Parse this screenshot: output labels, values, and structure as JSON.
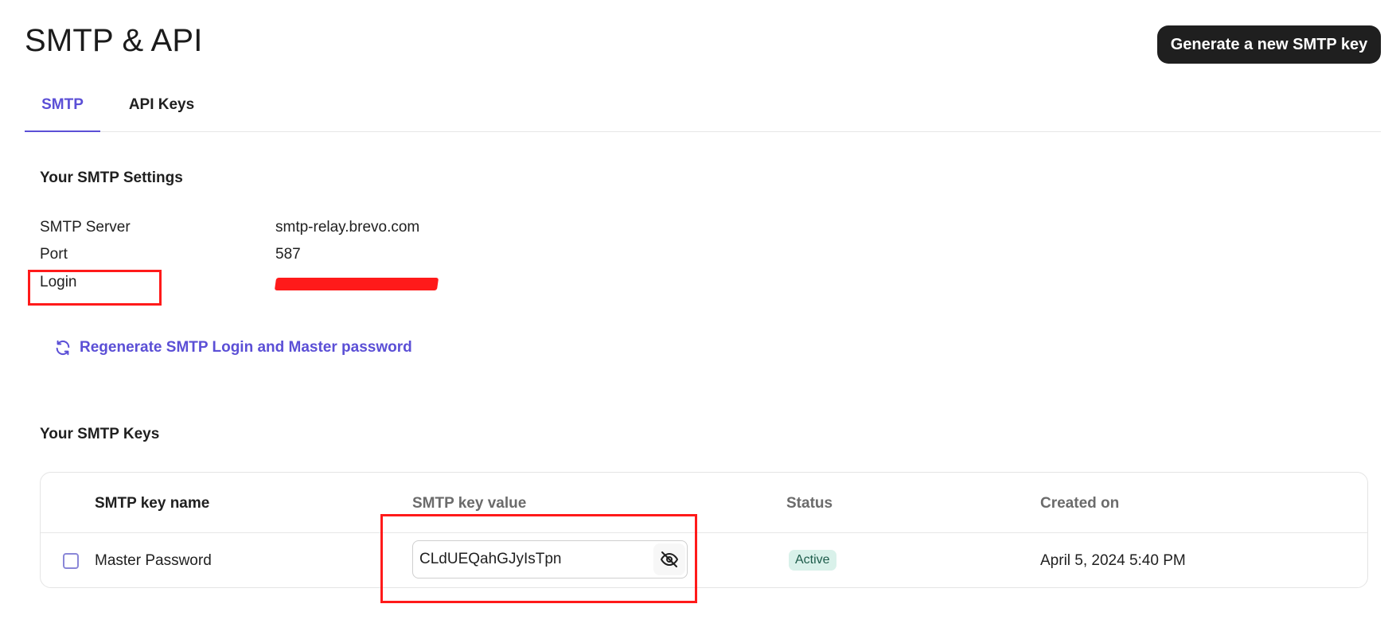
{
  "page": {
    "title": "SMTP & API"
  },
  "header": {
    "generate_button_label": "Generate a new SMTP key"
  },
  "tabs": [
    {
      "label": "SMTP",
      "active": true
    },
    {
      "label": "API Keys",
      "active": false
    }
  ],
  "settings": {
    "title": "Your SMTP Settings",
    "rows": [
      {
        "label": "SMTP Server",
        "value": "smtp-relay.brevo.com"
      },
      {
        "label": "Port",
        "value": "587"
      },
      {
        "label": "Login",
        "value": ""
      }
    ],
    "regenerate_link_label": "Regenerate SMTP Login and Master password"
  },
  "keys": {
    "title": "Your SMTP Keys",
    "columns": [
      "SMTP key name",
      "SMTP key value",
      "Status",
      "Created on"
    ],
    "rows": [
      {
        "name": "Master Password",
        "value": "CLdUEQahGJyIsTpn",
        "status": "Active",
        "created_on": "April 5, 2024 5:40 PM",
        "checked": false
      }
    ]
  },
  "icons": {
    "regenerate": "refresh-icon",
    "visibility": "eye-off-icon"
  },
  "colors": {
    "accent": "#5b4fd6",
    "primary_button_bg": "#1f1f1f",
    "status_active_bg": "#d9f1ea",
    "highlight": "#ff1a1a"
  }
}
